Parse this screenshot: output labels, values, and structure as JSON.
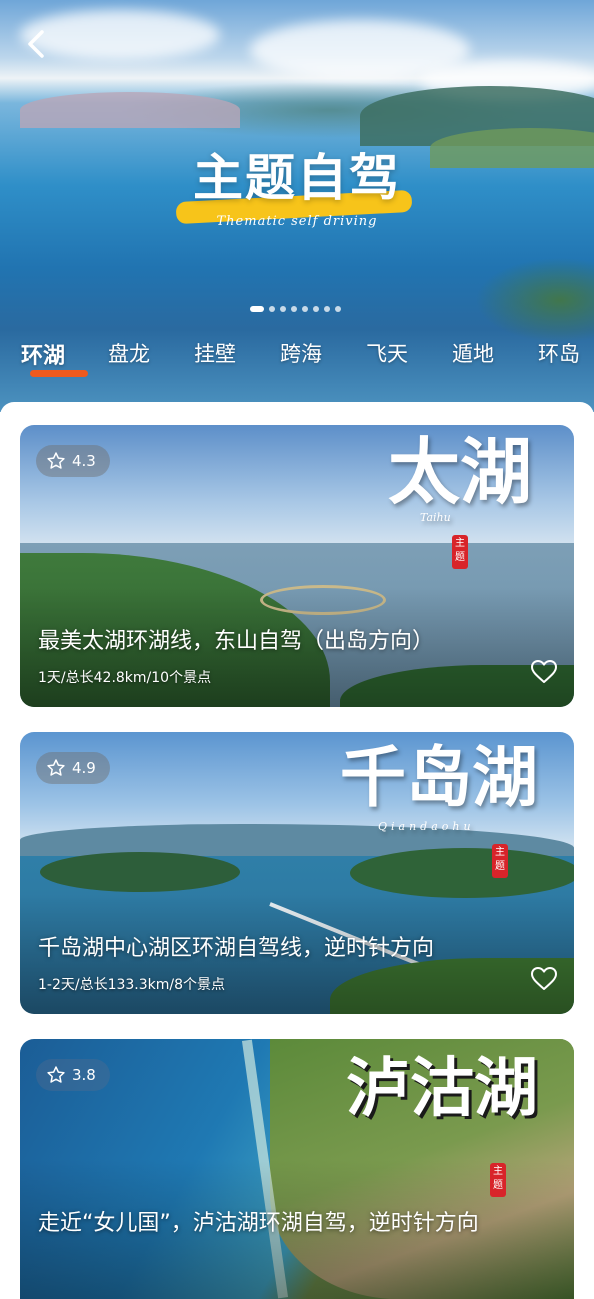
{
  "header": {
    "back_icon": "chevron-left-icon",
    "title": "主题自驾",
    "subtitle": "Thematic self driving",
    "carousel": {
      "count": 8,
      "active_index": 0
    }
  },
  "tabs": [
    {
      "label": "环湖",
      "active": true
    },
    {
      "label": "盘龙",
      "active": false
    },
    {
      "label": "挂壁",
      "active": false
    },
    {
      "label": "跨海",
      "active": false
    },
    {
      "label": "飞天",
      "active": false
    },
    {
      "label": "遁地",
      "active": false
    },
    {
      "label": "环岛",
      "active": false
    }
  ],
  "colors": {
    "accent": "#ee5a1d",
    "title_highlight": "#f7c41a",
    "seal": "#d8242a"
  },
  "routes": [
    {
      "rating": "4.3",
      "brush_title": "太湖",
      "brush_pinyin": "Taihu",
      "seal": "主题",
      "title": "最美太湖环湖线，东山自驾（出岛方向）",
      "meta": "1天/总长42.8km/10个景点",
      "favorite_icon": "heart-outline-icon"
    },
    {
      "rating": "4.9",
      "brush_title": "千岛湖",
      "brush_pinyin": "Qiandaohu",
      "seal": "主题",
      "title": "千岛湖中心湖区环湖自驾线，逆时针方向",
      "meta": "1-2天/总长133.3km/8个景点",
      "favorite_icon": "heart-outline-icon"
    },
    {
      "rating": "3.8",
      "brush_title": "泸沽湖",
      "brush_pinyin": "",
      "seal": "主题",
      "title": "走近“女儿国”，泸沽湖环湖自驾，逆时针方向",
      "meta": "",
      "favorite_icon": "heart-outline-icon"
    }
  ]
}
